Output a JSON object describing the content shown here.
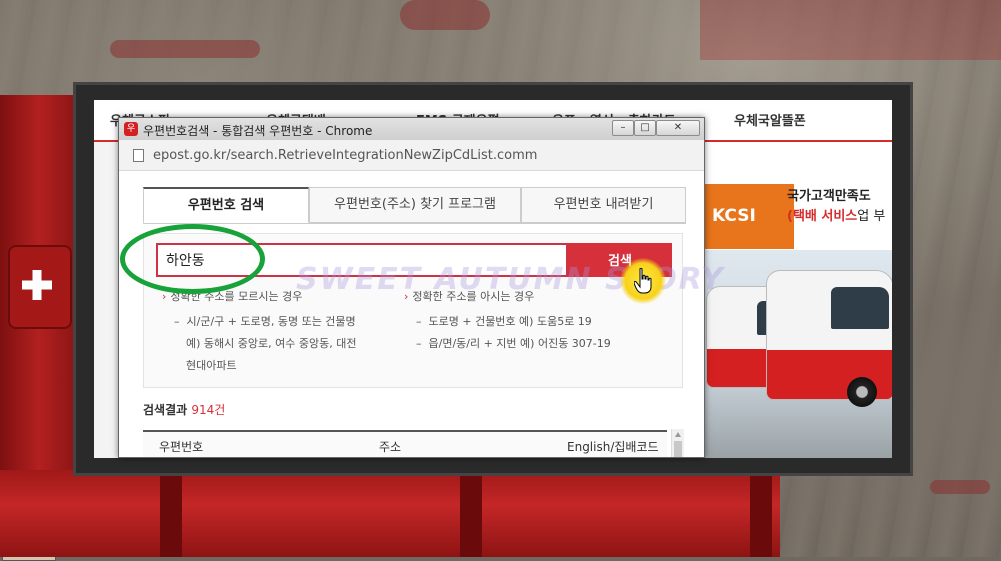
{
  "site_nav": {
    "items": [
      "우체국쇼핑",
      "우체국택배",
      "EMS 국제우편",
      "우표 · 엽서 · 축하카드",
      "우체국알뜰폰"
    ]
  },
  "ad": {
    "logo_text": "KCSI",
    "line1": "국가고객만족도",
    "line2_highlight": "(택배 서비스",
    "line2_rest": "업 부"
  },
  "window": {
    "title": "우편번호검색 - 통합검색 우편번호 - Chrome",
    "url": "epost.go.kr/search.RetrieveIntegrationNewZipCdList.comm",
    "buttons": {
      "minimize": "–",
      "maximize": "□",
      "close": "✕"
    }
  },
  "tabs": [
    {
      "label": "우편번호 검색",
      "active": true
    },
    {
      "label": "우편번호(주소) 찾기 프로그램",
      "active": false
    },
    {
      "label": "우편번호 내려받기",
      "active": false
    }
  ],
  "search": {
    "value": "하안동",
    "button": "검색"
  },
  "hints": {
    "left_title": "정확한 주소를 모르시는 경우",
    "left_items": [
      "시/군/구 + 도로명, 동명 또는 건물명",
      "예) 동해시 중앙로, 여수 중앙동, 대전",
      "현대아파트"
    ],
    "right_title": "정확한 주소를 아시는 경우",
    "right_items": [
      "도로명 + 건물번호 예) 도움5로 19",
      "읍/면/동/리 + 지번 예) 어진동 307-19"
    ]
  },
  "results": {
    "label": "검색결과",
    "count": "914",
    "unit": "건",
    "columns": [
      "우편번호",
      "주소",
      "English/집배코드"
    ]
  },
  "watermark": "SWEET AUTUMN STORY",
  "colors": {
    "accent_red": "#d6303a",
    "highlight_green": "#17a23a",
    "cursor_yellow": "#f7d21a"
  }
}
